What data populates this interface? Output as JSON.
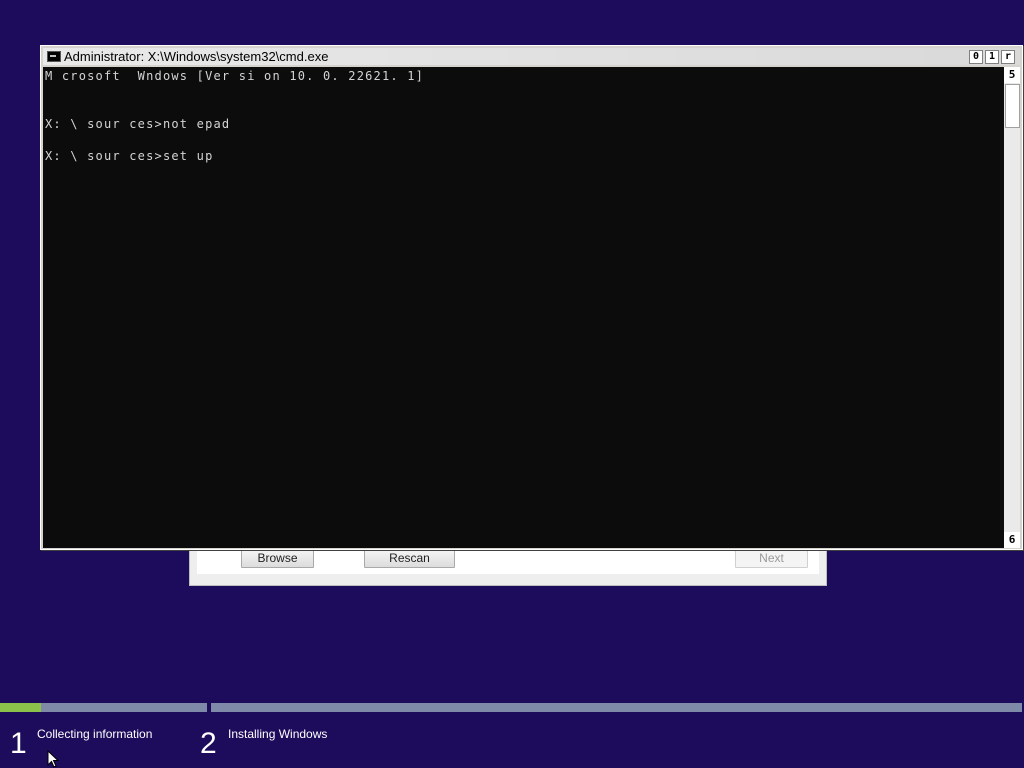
{
  "setup_dialog": {
    "browse_label": "Browse",
    "rescan_label": "Rescan",
    "next_label": "Next"
  },
  "cmd_window": {
    "title": "Administrator: X:\\Windows\\system32\\cmd.exe",
    "minimize_glyph": "0",
    "maximize_glyph": "1",
    "close_glyph": "r",
    "scroll_up_glyph": "5",
    "scroll_down_glyph": "6",
    "console_lines": [
      "M crosoft  Wndows [Ver si on 10. 0. 22621. 1]",
      "X: \\ sour ces>not epad",
      "X: \\ sour ces>set up"
    ]
  },
  "progress": {
    "fill_fraction": 0.2,
    "fill_color": "#8bc34a",
    "track_color": "#7f8aa8"
  },
  "steps": [
    {
      "number": "1",
      "label": "Collecting information"
    },
    {
      "number": "2",
      "label": "Installing Windows"
    }
  ],
  "colors": {
    "background": "#1d0b5c",
    "console_bg": "#0c0c0c",
    "console_text": "#d4d4d4"
  }
}
